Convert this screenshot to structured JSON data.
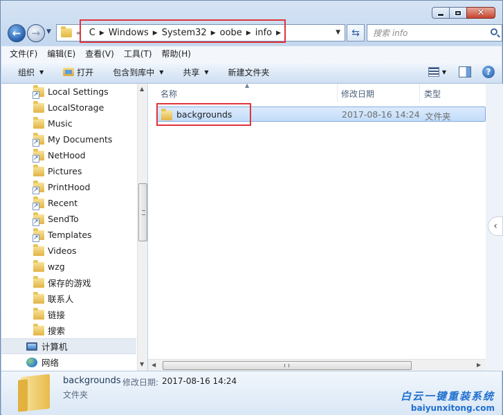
{
  "address_bar": {
    "overflow_chevron": "«",
    "crumbs": [
      "C",
      "Windows",
      "System32",
      "oobe",
      "info"
    ]
  },
  "search": {
    "placeholder": "搜索 info"
  },
  "menu": [
    "文件(F)",
    "编辑(E)",
    "查看(V)",
    "工具(T)",
    "帮助(H)"
  ],
  "toolbar": {
    "organize": "组织",
    "open": "打开",
    "include_library": "包含到库中",
    "share": "共享",
    "new_folder": "新建文件夹"
  },
  "nav_pane": {
    "items": [
      {
        "label": "Local Settings",
        "icon": "folder-shortcut-icon"
      },
      {
        "label": "LocalStorage",
        "icon": "folder-icon"
      },
      {
        "label": "Music",
        "icon": "folder-icon"
      },
      {
        "label": "My Documents",
        "icon": "folder-shortcut-icon"
      },
      {
        "label": "NetHood",
        "icon": "folder-shortcut-icon"
      },
      {
        "label": "Pictures",
        "icon": "folder-icon"
      },
      {
        "label": "PrintHood",
        "icon": "folder-shortcut-icon"
      },
      {
        "label": "Recent",
        "icon": "folder-shortcut-icon"
      },
      {
        "label": "SendTo",
        "icon": "folder-shortcut-icon"
      },
      {
        "label": "Templates",
        "icon": "folder-shortcut-icon"
      },
      {
        "label": "Videos",
        "icon": "folder-icon"
      },
      {
        "label": "wzg",
        "icon": "folder-icon"
      },
      {
        "label": "保存的游戏",
        "icon": "folder-icon"
      },
      {
        "label": "联系人",
        "icon": "folder-icon"
      },
      {
        "label": "链接",
        "icon": "folder-icon"
      },
      {
        "label": "搜索",
        "icon": "folder-icon"
      }
    ],
    "computer": "计算机",
    "network": "网络"
  },
  "columns": {
    "name": "名称",
    "modified": "修改日期",
    "type": "类型"
  },
  "files": [
    {
      "name": "backgrounds",
      "modified": "2017-08-16 14:24",
      "type": "文件夹"
    }
  ],
  "details": {
    "name": "backgrounds",
    "modified_label": "修改日期:",
    "modified": "2017-08-16 14:24",
    "type": "文件夹"
  },
  "watermark": {
    "title": "白云一键重装系统",
    "url": "baiyunxitong.com"
  },
  "colors": {
    "highlight_box": "#e0333a",
    "selection": "#c2dcfa",
    "watermark": "#1f6fcf"
  }
}
